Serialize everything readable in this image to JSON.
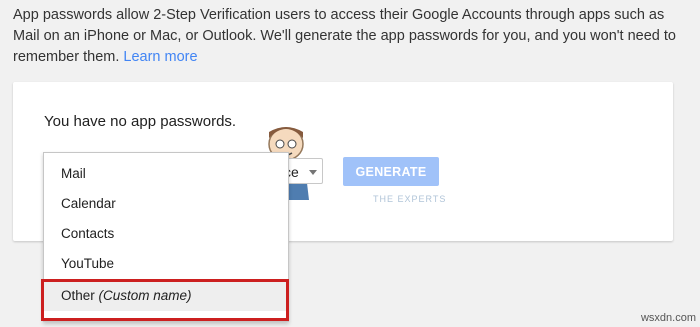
{
  "intro": {
    "text": "App passwords allow 2-Step Verification users to access their Google Accounts through apps such as Mail on an iPhone or Mac, or Outlook. We'll generate the app passwords for you, and you won't need to remember them.",
    "learn_more": "Learn more"
  },
  "card": {
    "no_passwords_text": "You have no app passwords.",
    "device_select_value": "ce",
    "generate_label": "GENERATE"
  },
  "app_dropdown": {
    "items": [
      {
        "label": "Mail"
      },
      {
        "label": "Calendar"
      },
      {
        "label": "Contacts"
      },
      {
        "label": "YouTube"
      },
      {
        "label": "Other",
        "suffix": "(Custom name)"
      }
    ]
  },
  "watermark": {
    "brand": "A",
    "tagline": "THE EXPERTS",
    "site": "wsxdn.com"
  },
  "colors": {
    "background": "#f1f1f1",
    "card": "#ffffff",
    "link": "#4285f4",
    "button_disabled": "#a0c2f9",
    "highlight_border": "#cc1f1f",
    "item_hover": "#eeeeee"
  }
}
